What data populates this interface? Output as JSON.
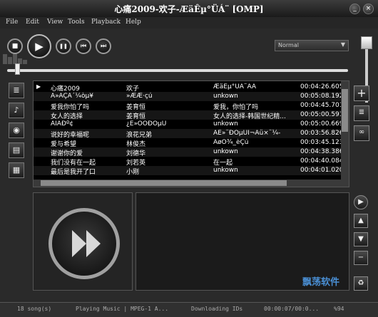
{
  "window": {
    "title": "心痛2009-欢子-ÆäÊµ°ÜÁ¨ [OMP]",
    "minimize": "_",
    "close": "×"
  },
  "menu": [
    "File",
    "Edit",
    "View",
    "Tools",
    "Playback",
    "Help"
  ],
  "controls": {
    "stop": "■",
    "play": "▶",
    "pause": "❚❚",
    "prev": "⏮",
    "next": "⏭"
  },
  "eq_preset": {
    "selected": "Normal",
    "arrow": "▼"
  },
  "seek": {
    "position": 0.03
  },
  "volume": {
    "level": 0.95
  },
  "left_sidebar": [
    {
      "name": "playlist-view",
      "glyph": "≣"
    },
    {
      "name": "lyrics-view",
      "glyph": "♪"
    },
    {
      "name": "cd-view",
      "glyph": "◉"
    },
    {
      "name": "media-library",
      "glyph": "▤"
    },
    {
      "name": "video-view",
      "glyph": "▦"
    }
  ],
  "right_sidebar_top": [
    {
      "name": "add",
      "glyph": "+"
    },
    {
      "name": "list",
      "glyph": "≣"
    },
    {
      "name": "connect",
      "glyph": "∞"
    }
  ],
  "right_sidebar_bottom": [
    {
      "name": "play",
      "glyph": "▶"
    },
    {
      "name": "move-up",
      "glyph": "▲"
    },
    {
      "name": "move-down",
      "glyph": "▼"
    },
    {
      "name": "remove",
      "glyph": "−"
    },
    {
      "name": "recycle",
      "glyph": "♻"
    }
  ],
  "playlist": {
    "rows": [
      {
        "title": "心痛2009",
        "artist": "欢子",
        "album": "ÆäÊµ°ÜÁ¨ÃÃ",
        "time": "00:04:26.605",
        "playing": true
      },
      {
        "title": "Ã»ÄÇÃ´¼òµ¥",
        "artist": "»ÆÆ·çú",
        "album": "unkown",
        "time": "00:05:08.192",
        "playing": false
      },
      {
        "title": "爱我你怕了吗",
        "artist": "姜育恒",
        "album": "爱我，你怕了吗",
        "time": "00:04:45.701",
        "playing": false
      },
      {
        "title": "女人的选择",
        "artist": "姜育恒",
        "album": "女人的选择-韩国世纪精...",
        "time": "00:05:00.591",
        "playing": false
      },
      {
        "title": "ÄÌÄÐº¢",
        "artist": "¿É»ÔÕÐÕµÜ",
        "album": "unkown",
        "time": "00:05:00.669",
        "playing": false
      },
      {
        "title": "说好的幸福呢",
        "artist": "浪花兄弟",
        "album": "ÀÉ»¨ÐÖµÜÏ¬Ãü×¨¼-",
        "time": "00:03:56.826",
        "playing": false
      },
      {
        "title": "爱与希望",
        "artist": "林俊杰",
        "album": "ÀøÓ¾_èÇú",
        "time": "00:03:45.123",
        "playing": false
      },
      {
        "title": "谢谢你的爱",
        "artist": "刘德华",
        "album": "unkown",
        "time": "00:04:38.386",
        "playing": false
      },
      {
        "title": "我们没有在一起",
        "artist": "刘若英",
        "album": "在一起",
        "time": "00:04:40.084",
        "playing": false
      },
      {
        "title": "最后是我开了口",
        "artist": "小刚",
        "album": "unkown",
        "time": "00:04:01.020",
        "playing": false
      }
    ]
  },
  "status": {
    "song_count": "18 song(s)",
    "state": "Playing Music | MPEG-1 A...",
    "downloading": "Downloading IDs",
    "time": "00:00:07/00:0...",
    "volume": "%94"
  },
  "watermark": "飘荡软件",
  "colors": {
    "accent_watermark": "#4a8fd4",
    "list_bg": "#000000",
    "text": "#ffffff"
  }
}
